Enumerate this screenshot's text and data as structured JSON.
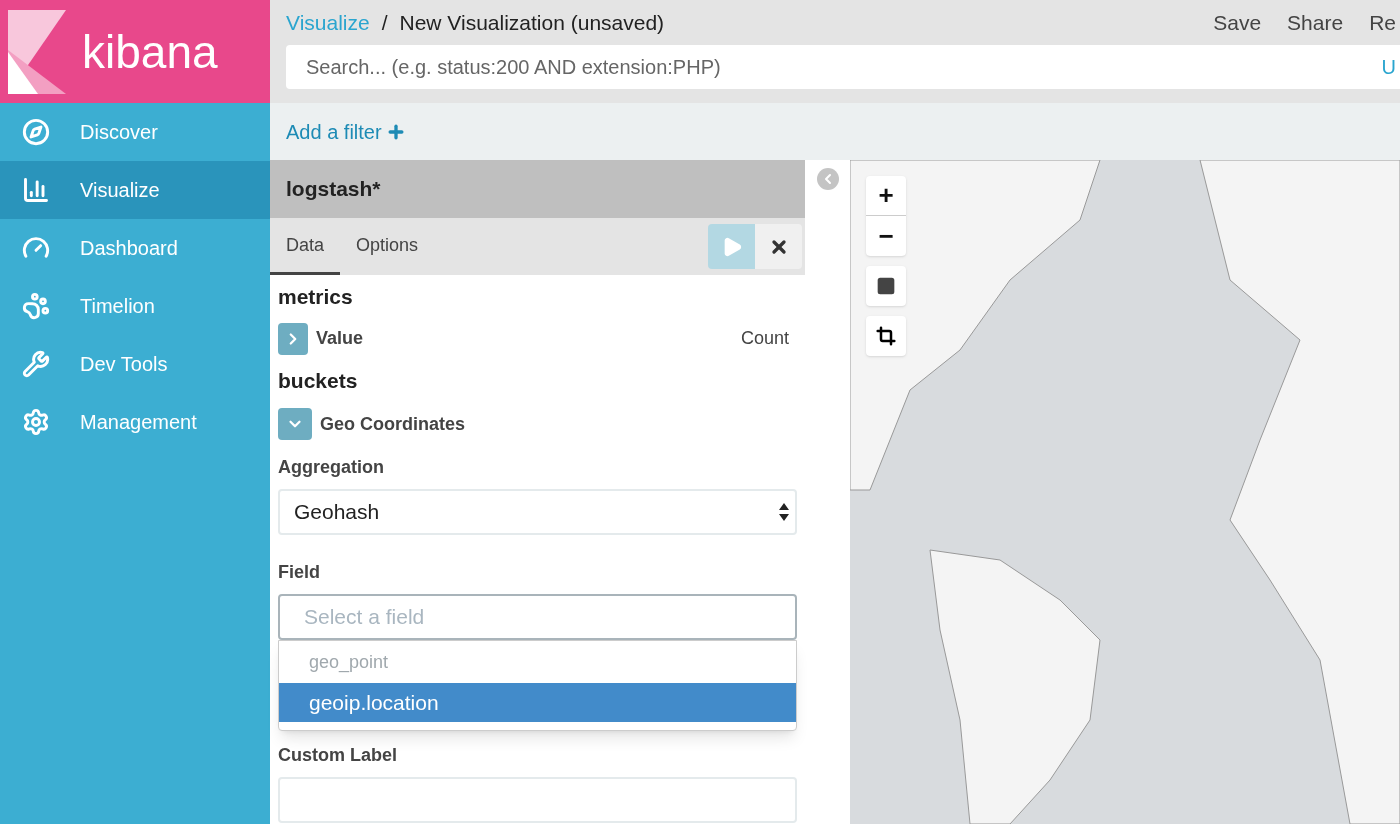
{
  "sidebar": {
    "logo": "kibana",
    "items": [
      {
        "label": "Discover",
        "selected": false
      },
      {
        "label": "Visualize",
        "selected": true
      },
      {
        "label": "Dashboard",
        "selected": false
      },
      {
        "label": "Timelion",
        "selected": false
      },
      {
        "label": "Dev Tools",
        "selected": false
      },
      {
        "label": "Management",
        "selected": false
      }
    ]
  },
  "header": {
    "breadcrumb_link": "Visualize",
    "separator": "/",
    "title": "New Visualization (unsaved)",
    "actions": [
      "Save",
      "Share",
      "Re"
    ]
  },
  "search": {
    "placeholder": "Search... (e.g. status:200 AND extension:PHP)",
    "trailing": "U"
  },
  "filter_bar": {
    "add_filter": "Add a filter"
  },
  "editor": {
    "index_pattern": "logstash*",
    "tabs": [
      {
        "label": "Data",
        "selected": true
      },
      {
        "label": "Options",
        "selected": false
      }
    ],
    "metrics": {
      "title": "metrics",
      "item": {
        "label": "Value",
        "value": "Count",
        "expanded": false
      }
    },
    "buckets": {
      "title": "buckets",
      "item": {
        "label": "Geo Coordinates",
        "expanded": true
      }
    },
    "aggregation": {
      "label": "Aggregation",
      "value": "Geohash"
    },
    "field": {
      "label": "Field",
      "placeholder": "Select a field",
      "group": "geo_point",
      "options": [
        {
          "label": "geoip.location",
          "selected": true
        }
      ]
    },
    "custom_label": {
      "label": "Custom Label"
    }
  },
  "map": {
    "zoom_in": "+",
    "zoom_out": "−"
  }
}
